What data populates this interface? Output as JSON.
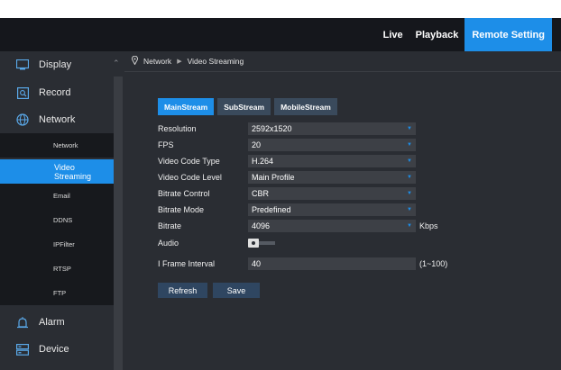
{
  "topnav": {
    "items": [
      {
        "label": "Live"
      },
      {
        "label": "Playback"
      },
      {
        "label": "Remote Setting"
      }
    ]
  },
  "sidebar": {
    "display": "Display",
    "record": "Record",
    "network": "Network",
    "sub": [
      "Network",
      "Video Streaming",
      "Email",
      "DDNS",
      "IPFilter",
      "RTSP",
      "FTP"
    ],
    "alarm": "Alarm",
    "device": "Device"
  },
  "breadcrumb": {
    "root": "Network",
    "current": "Video Streaming"
  },
  "tabs": [
    "MainStream",
    "SubStream",
    "MobileStream"
  ],
  "form": {
    "resolution": {
      "label": "Resolution",
      "value": "2592x1520"
    },
    "fps": {
      "label": "FPS",
      "value": "20"
    },
    "video_code_type": {
      "label": "Video Code Type",
      "value": "H.264"
    },
    "video_code_level": {
      "label": "Video Code Level",
      "value": "Main Profile"
    },
    "bitrate_control": {
      "label": "Bitrate Control",
      "value": "CBR"
    },
    "bitrate_mode": {
      "label": "Bitrate Mode",
      "value": "Predefined"
    },
    "bitrate": {
      "label": "Bitrate",
      "value": "4096",
      "unit": "Kbps"
    },
    "audio": {
      "label": "Audio",
      "enabled": false
    },
    "i_frame_interval": {
      "label": "I Frame Interval",
      "value": "40",
      "range": "(1~100)"
    }
  },
  "buttons": {
    "refresh": "Refresh",
    "save": "Save"
  },
  "colors": {
    "accent": "#1d8ee8",
    "panel": "#2a2d33",
    "topbar": "#15171c"
  }
}
